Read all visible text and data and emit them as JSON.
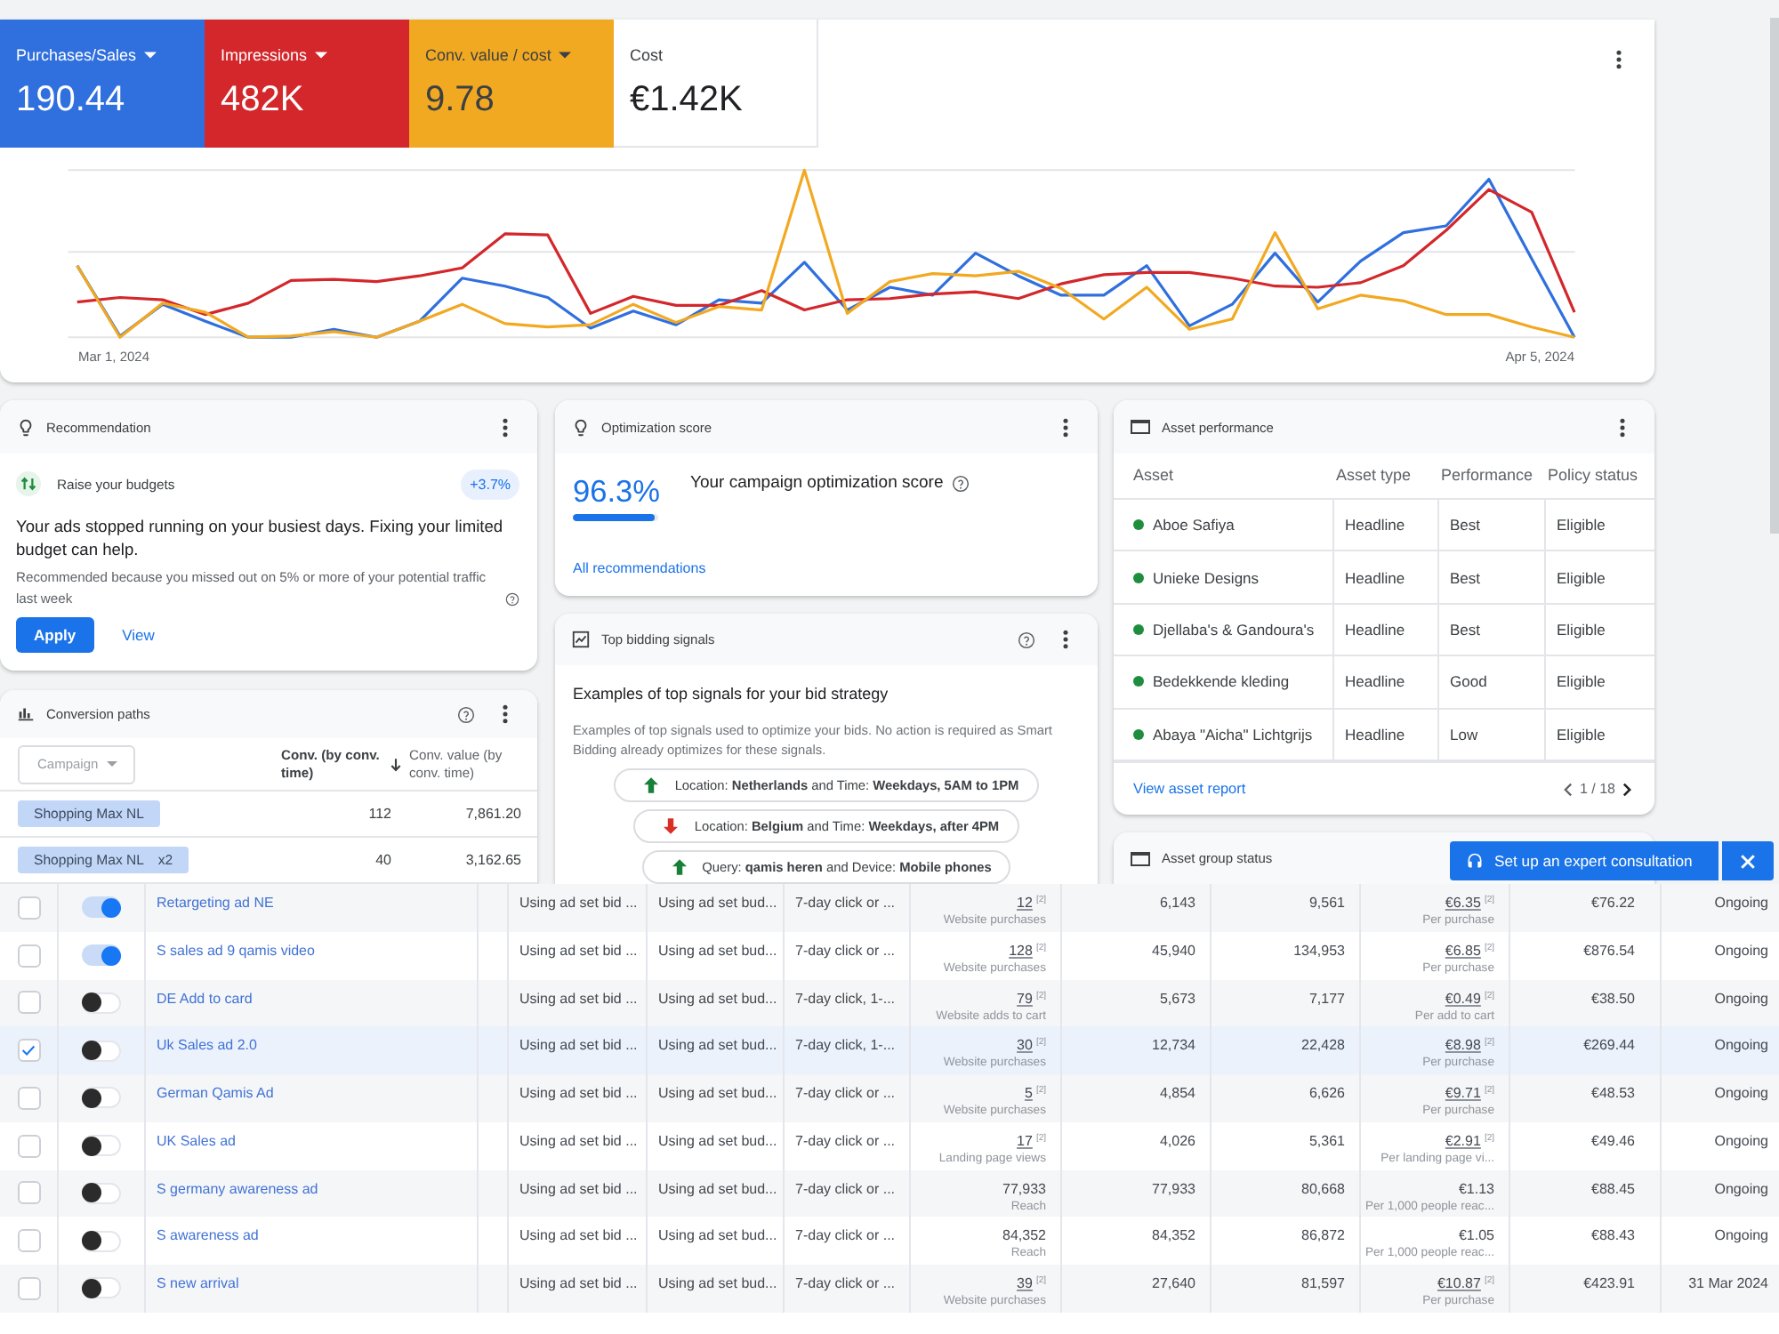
{
  "summary": {
    "metrics": [
      {
        "label": "Purchases/Sales",
        "value": "190.44",
        "selected": true,
        "color": "#2f6fde"
      },
      {
        "label": "Impressions",
        "value": "482K",
        "selected": true,
        "color": "#d3272b"
      },
      {
        "label": "Conv. value / cost",
        "value": "9.78",
        "selected": true,
        "color": "#f2a922"
      },
      {
        "label": "Cost",
        "value": "€1.42K",
        "selected": false
      }
    ],
    "chart": {
      "start_label": "Mar 1, 2024",
      "end_label": "Apr 5, 2024"
    }
  },
  "recommendation": {
    "title": "Recommendation",
    "item": "Raise your budgets",
    "badge": "+3.7%",
    "message": "Your ads stopped running on your busiest days. Fixing your limited budget can help.",
    "reason": "Recommended because you missed out on 5% or more of your potential traffic last week",
    "apply": "Apply",
    "view": "View"
  },
  "conversion_paths": {
    "title": "Conversion paths",
    "filter": "Campaign",
    "columns": [
      {
        "label": "Conv. (by conv. time)",
        "sorted": true
      },
      {
        "label": "Conv. value (by conv. time)",
        "sorted": false
      }
    ],
    "rows": [
      {
        "campaign": "Shopping Max NL",
        "conversions": "112",
        "value": "7,861.20"
      },
      {
        "campaign": "Shopping Max NL",
        "repeat": "x2",
        "conversions": "40",
        "value": "3,162.65"
      }
    ]
  },
  "optimization_score": {
    "title": "Optimization score",
    "score": "96.3%",
    "level": 0.963,
    "caption": "Your campaign optimization score",
    "link": "All recommendations"
  },
  "bidding_signals": {
    "title": "Top bidding signals",
    "heading": "Examples of top signals for your bid strategy",
    "description": "Examples of top signals used to optimize your bids. No action is required as Smart Bidding already optimizes for these signals.",
    "signals": [
      {
        "kind": "up",
        "text": "Location: **Netherlands** and Time: **Weekdays, 5AM to 1PM**"
      },
      {
        "kind": "down",
        "text": "Location: **Belgium** and Time: **Weekdays, after 4PM**"
      },
      {
        "kind": "up",
        "text": "Query: **qamis heren** and Device: **Mobile phones**"
      }
    ]
  },
  "asset_performance": {
    "title": "Asset performance",
    "columns": [
      "Asset",
      "Asset type",
      "Performance",
      "Policy status"
    ],
    "rows": [
      {
        "asset": "Aboe Safiya",
        "color": "#1e8e3e",
        "type": "Headline",
        "performance": "Best",
        "policy": "Eligible"
      },
      {
        "asset": "Unieke Designs",
        "color": "#1e8e3e",
        "type": "Headline",
        "performance": "Best",
        "policy": "Eligible"
      },
      {
        "asset": "Djellaba's & Gandoura's",
        "color": "#1e8e3e",
        "type": "Headline",
        "performance": "Best",
        "policy": "Eligible"
      },
      {
        "asset": "Bedekkende kleding",
        "color": "#1e8e3e",
        "type": "Headline",
        "performance": "Good",
        "policy": "Eligible"
      },
      {
        "asset": "Abaya \"Aicha\" Lichtgrijs",
        "color": "#1e8e3e",
        "type": "Headline",
        "performance": "Low",
        "policy": "Eligible"
      }
    ],
    "link": "View asset report",
    "pager": "1 / 18"
  },
  "asset_group_status": {
    "title": "Asset group status"
  },
  "consultation": {
    "label": "Set up an expert consultation"
  },
  "ads_table": {
    "rows": [
      {
        "selected": false,
        "on": true,
        "name": "Retargeting ad NE",
        "cells": [
          {
            "value": "Using ad set bid ..."
          },
          {
            "value": "Using ad set bud..."
          },
          {
            "value": "7-day click or ..."
          },
          {
            "value": "12",
            "note": "[2]",
            "label": "Website purchases"
          },
          {
            "value": "6,143"
          },
          {
            "value": "9,561"
          },
          {
            "value": "€6.35",
            "note": "[2]",
            "label": "Per purchase"
          },
          {
            "value": "€76.22"
          },
          {
            "value": "Ongoing"
          }
        ]
      },
      {
        "selected": false,
        "on": true,
        "name": "S sales ad 9 qamis video",
        "cells": [
          {
            "value": "Using ad set bid ..."
          },
          {
            "value": "Using ad set bud..."
          },
          {
            "value": "7-day click or ..."
          },
          {
            "value": "128",
            "note": "[2]",
            "label": "Website purchases"
          },
          {
            "value": "45,940"
          },
          {
            "value": "134,953"
          },
          {
            "value": "€6.85",
            "note": "[2]",
            "label": "Per purchase"
          },
          {
            "value": "€876.54"
          },
          {
            "value": "Ongoing"
          }
        ]
      },
      {
        "selected": false,
        "on": false,
        "name": "DE Add to card",
        "cells": [
          {
            "value": "Using ad set bid ..."
          },
          {
            "value": "Using ad set bud..."
          },
          {
            "value": "7-day click, 1-..."
          },
          {
            "value": "79",
            "note": "[2]",
            "label": "Website adds to cart"
          },
          {
            "value": "5,673"
          },
          {
            "value": "7,177"
          },
          {
            "value": "€0.49",
            "note": "[2]",
            "label": "Per add to cart"
          },
          {
            "value": "€38.50"
          },
          {
            "value": "Ongoing"
          }
        ]
      },
      {
        "selected": true,
        "on": false,
        "name": "Uk Sales ad 2.0",
        "cells": [
          {
            "value": "Using ad set bid ..."
          },
          {
            "value": "Using ad set bud..."
          },
          {
            "value": "7-day click, 1-..."
          },
          {
            "value": "30",
            "note": "[2]",
            "label": "Website purchases"
          },
          {
            "value": "12,734"
          },
          {
            "value": "22,428"
          },
          {
            "value": "€8.98",
            "note": "[2]",
            "label": "Per purchase"
          },
          {
            "value": "€269.44"
          },
          {
            "value": "Ongoing"
          }
        ]
      },
      {
        "selected": false,
        "on": false,
        "name": "German Qamis Ad",
        "cells": [
          {
            "value": "Using ad set bid ..."
          },
          {
            "value": "Using ad set bud..."
          },
          {
            "value": "7-day click or ..."
          },
          {
            "value": "5",
            "note": "[2]",
            "label": "Website purchases"
          },
          {
            "value": "4,854"
          },
          {
            "value": "6,626"
          },
          {
            "value": "€9.71",
            "note": "[2]",
            "label": "Per purchase"
          },
          {
            "value": "€48.53"
          },
          {
            "value": "Ongoing"
          }
        ]
      },
      {
        "selected": false,
        "on": false,
        "name": "UK Sales ad",
        "cells": [
          {
            "value": "Using ad set bid ..."
          },
          {
            "value": "Using ad set bud..."
          },
          {
            "value": "7-day click or ..."
          },
          {
            "value": "17",
            "note": "[2]",
            "label": "Landing page views"
          },
          {
            "value": "4,026"
          },
          {
            "value": "5,361"
          },
          {
            "value": "€2.91",
            "note": "[2]",
            "label": "Per landing page vi..."
          },
          {
            "value": "€49.46"
          },
          {
            "value": "Ongoing"
          }
        ]
      },
      {
        "selected": false,
        "on": false,
        "name": "S germany awareness ad",
        "cells": [
          {
            "value": "Using ad set bid ..."
          },
          {
            "value": "Using ad set bud..."
          },
          {
            "value": "7-day click or ..."
          },
          {
            "value": "77,933",
            "label": "Reach"
          },
          {
            "value": "77,933"
          },
          {
            "value": "80,668"
          },
          {
            "value": "€1.13",
            "label": "Per 1,000 people reac..."
          },
          {
            "value": "€88.45"
          },
          {
            "value": "Ongoing"
          }
        ]
      },
      {
        "selected": false,
        "on": false,
        "name": "S awareness ad",
        "cells": [
          {
            "value": "Using ad set bid ..."
          },
          {
            "value": "Using ad set bud..."
          },
          {
            "value": "7-day click or ..."
          },
          {
            "value": "84,352",
            "label": "Reach"
          },
          {
            "value": "84,352"
          },
          {
            "value": "86,872"
          },
          {
            "value": "€1.05",
            "label": "Per 1,000 people reac..."
          },
          {
            "value": "€88.43"
          },
          {
            "value": "Ongoing"
          }
        ]
      },
      {
        "selected": false,
        "on": false,
        "name": "S new arrival",
        "cells": [
          {
            "value": "Using ad set bid ..."
          },
          {
            "value": "Using ad set bud..."
          },
          {
            "value": "7-day click or ..."
          },
          {
            "value": "39",
            "note": "[2]",
            "label": "Website purchases"
          },
          {
            "value": "27,640"
          },
          {
            "value": "81,597"
          },
          {
            "value": "€10.87",
            "note": "[2]",
            "label": "Per purchase"
          },
          {
            "value": "€423.91"
          },
          {
            "value": "31 Mar 2024"
          }
        ]
      }
    ]
  }
}
